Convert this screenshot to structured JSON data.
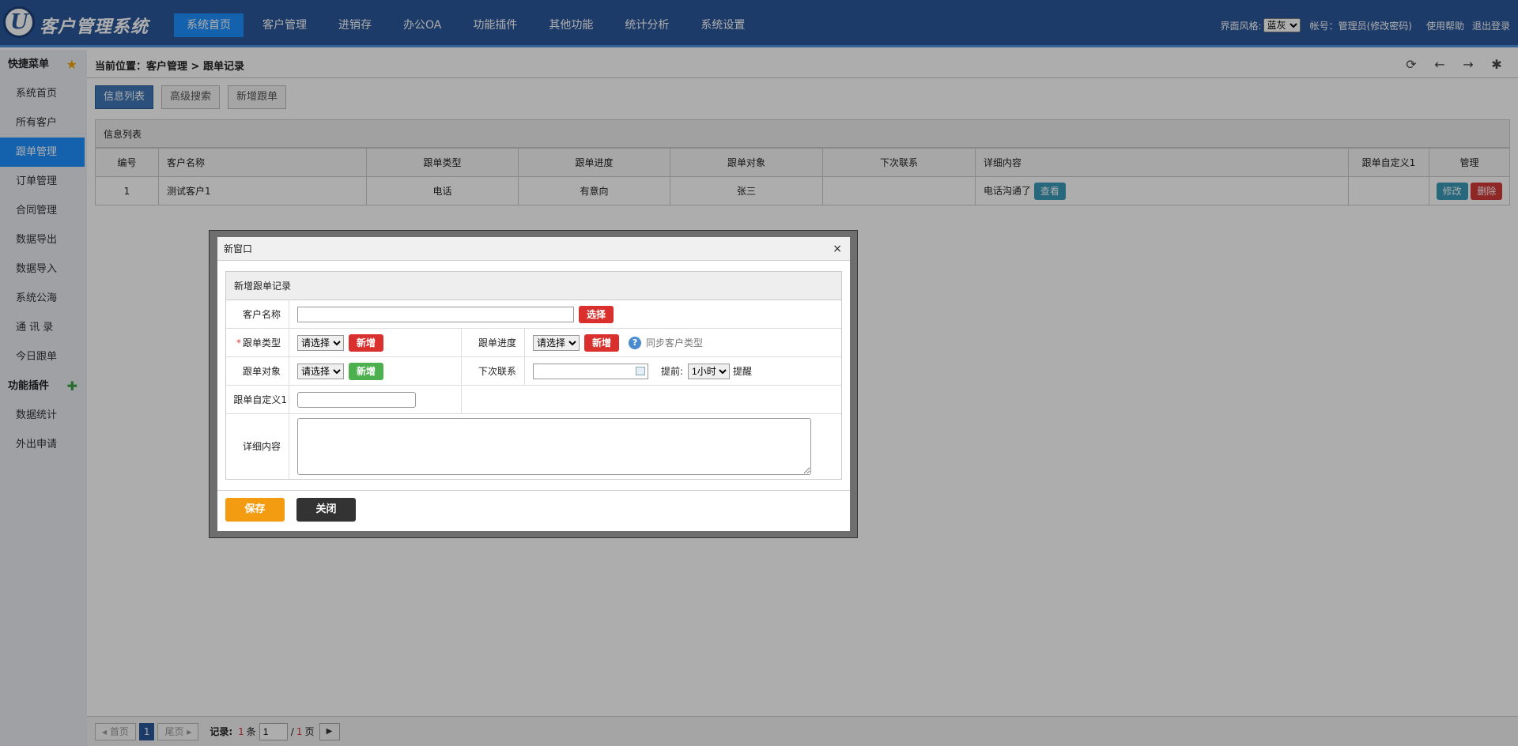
{
  "header": {
    "logo_glyph": "U",
    "brand": "客户管理系统",
    "nav": [
      "系统首页",
      "客户管理",
      "进销存",
      "办公OA",
      "功能插件",
      "其他功能",
      "统计分析",
      "系统设置"
    ],
    "skin_label": "界面风格:",
    "skin_value": "蓝灰",
    "account": "帐号：管理员(修改密码)",
    "help": "使用帮助",
    "logout": "退出登录"
  },
  "sidebar": {
    "quick_title": "快捷菜单",
    "quick_items": [
      "系统首页",
      "所有客户",
      "跟单管理",
      "订单管理",
      "合同管理",
      "数据导出",
      "数据导入",
      "系统公海",
      "通 讯 录",
      "今日跟单"
    ],
    "plugin_title": "功能插件",
    "plugin_items": [
      "数据统计",
      "外出申请"
    ]
  },
  "main": {
    "breadcrumb": "当前位置：客户管理 > 跟单记录",
    "tabs": [
      "信息列表",
      "高级搜索",
      "新增跟单"
    ],
    "list_title": "信息列表",
    "columns": [
      "编号",
      "客户名称",
      "跟单类型",
      "跟单进度",
      "跟单对象",
      "下次联系",
      "详细内容",
      "跟单自定义1",
      "管理"
    ],
    "rows": [
      {
        "id": "1",
        "customer": "测试客户1",
        "type": "电话",
        "progress": "有意向",
        "target": "张三",
        "next": "",
        "detail": "电话沟通了",
        "custom1": ""
      }
    ],
    "view_label": "查看",
    "edit_label": "修改",
    "delete_label": "删除"
  },
  "pager": {
    "first": "◂ 首页",
    "last": "尾页 ▸",
    "current": "1",
    "records_label": "记录:",
    "records_count": "1",
    "records_unit": "条",
    "page_input": "1",
    "slash": "/",
    "total_pages": "1",
    "page_unit": "页",
    "go": "▶"
  },
  "dialog": {
    "title": "新窗口",
    "close": "×",
    "form_title": "新增跟单记录",
    "customer_label": "客户名称",
    "choose_btn": "选择",
    "type_label": "跟单类型",
    "required_mark": "*",
    "select_placeholder": "请选择",
    "add_btn": "新增",
    "progress_label": "跟单进度",
    "sync_type": "同步客户类型",
    "target_label": "跟单对象",
    "next_label": "下次联系",
    "advance_label": "提前:",
    "advance_value": "1小时",
    "remind": "提醒",
    "custom1_label": "跟单自定义1",
    "detail_label": "详细内容",
    "save": "保存",
    "close_btn": "关闭"
  }
}
